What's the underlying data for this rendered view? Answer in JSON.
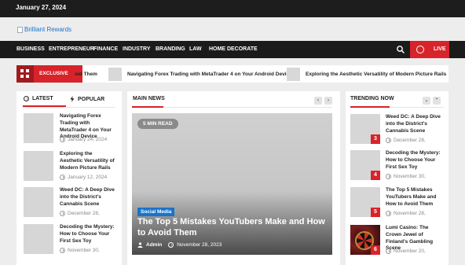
{
  "topbar": {
    "date": "January 27, 2024"
  },
  "brand": {
    "logo_alt": "Brilliant Rewards"
  },
  "nav": {
    "items": [
      "BUSINESS",
      "ENTREPRENEUR",
      "FINANCE",
      "INDUSTRY",
      "BRANDING",
      "LAW",
      "HOME DECORATE"
    ],
    "live_label": "LIVE"
  },
  "ticker": {
    "label": "EXCLUSIVE",
    "items": [
      "oid Them",
      "Navigating Forex Trading with MetaTrader 4 on Your Android Device",
      "Exploring the Aesthetic Versatility of Modern Picture Rails"
    ]
  },
  "left_tabs": {
    "tabs": [
      "LATEST",
      "POPULAR"
    ],
    "posts": [
      {
        "title": "Navigating Forex Trading with MetaTrader 4 on Your Android Device",
        "date": "January 24, 2024"
      },
      {
        "title": "Exploring the Aesthetic Versatility of Modern Picture Rails",
        "date": "January 12, 2024"
      },
      {
        "title": "Weed DC: A Deep Dive into the District's Cannabis Scene",
        "date": "December 28,"
      },
      {
        "title": "Decoding the Mystery: How to Choose Your First Sex Toy",
        "date": "November 30,"
      }
    ]
  },
  "main_news": {
    "heading": "MAIN NEWS",
    "prev_arrow": "‹",
    "next_arrow": "›",
    "hero": {
      "read_time": "5 MIN READ",
      "category": "Social Media",
      "title": "The Top 5 Mistakes YouTubers Make and How to Avoid Them",
      "author": "Admin",
      "date": "November 28, 2023"
    }
  },
  "trending": {
    "heading": "TRENDING NOW",
    "down_arrow": "⌄",
    "up_arrow": "⌃",
    "posts": [
      {
        "rank": "3",
        "title": "Weed DC: A Deep Dive into the District's Cannabis Scene",
        "date": "December 28,"
      },
      {
        "rank": "4",
        "title": "Decoding the Mystery: How to Choose Your First Sex Toy",
        "date": "November 30,"
      },
      {
        "rank": "5",
        "title": "The Top 5 Mistakes YouTubers Make and How to Avoid Them",
        "date": "November 28,"
      },
      {
        "rank": "6",
        "title": "Lumi Casino: The Crown Jewel of Finland's Gambling Scene",
        "date": "November 20,"
      }
    ]
  },
  "colors": {
    "accent": "#d8232a",
    "nav_bg": "#1b1b1b",
    "link": "#1a73c9"
  }
}
